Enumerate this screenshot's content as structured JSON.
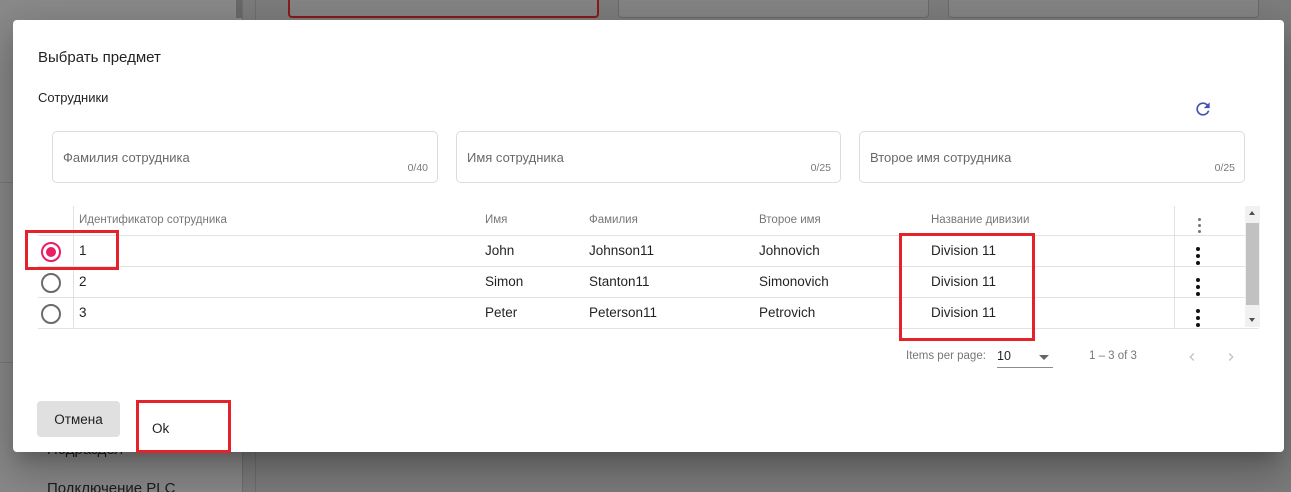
{
  "background": {
    "sidebar_items": [
      "Подраздел",
      "Подключение PLC"
    ]
  },
  "dialog": {
    "title": "Выбрать предмет",
    "section_title": "Сотрудники",
    "refresh_icon": "refresh-icon",
    "filters": [
      {
        "placeholder": "Фамилия сотрудника",
        "value": "",
        "counter": "0/40"
      },
      {
        "placeholder": "Имя сотрудника",
        "value": "",
        "counter": "0/25"
      },
      {
        "placeholder": "Второе имя сотрудника",
        "value": "",
        "counter": "0/25"
      }
    ],
    "table": {
      "columns": [
        "Идентификатор сотрудника",
        "Имя",
        "Фамилия",
        "Второе имя",
        "Название дивизии"
      ],
      "rows": [
        {
          "id": "1",
          "first_name": "John",
          "last_name": "Johnson11",
          "middle_name": "Johnovich",
          "division": "Division 11",
          "selected": true
        },
        {
          "id": "2",
          "first_name": "Simon",
          "last_name": "Stanton11",
          "middle_name": "Simonovich",
          "division": "Division 11",
          "selected": false
        },
        {
          "id": "3",
          "first_name": "Peter",
          "last_name": "Peterson11",
          "middle_name": "Petrovich",
          "division": "Division 11",
          "selected": false
        }
      ]
    },
    "paginator": {
      "items_per_page_label": "Items per page:",
      "page_size": "10",
      "range_label": "1 – 3 of 3"
    },
    "actions": {
      "cancel_label": "Отмена",
      "ok_label": "Ok"
    },
    "colors": {
      "accent": "#e91e63",
      "refresh": "#3f51b5",
      "annotation": "#e4222a"
    }
  }
}
